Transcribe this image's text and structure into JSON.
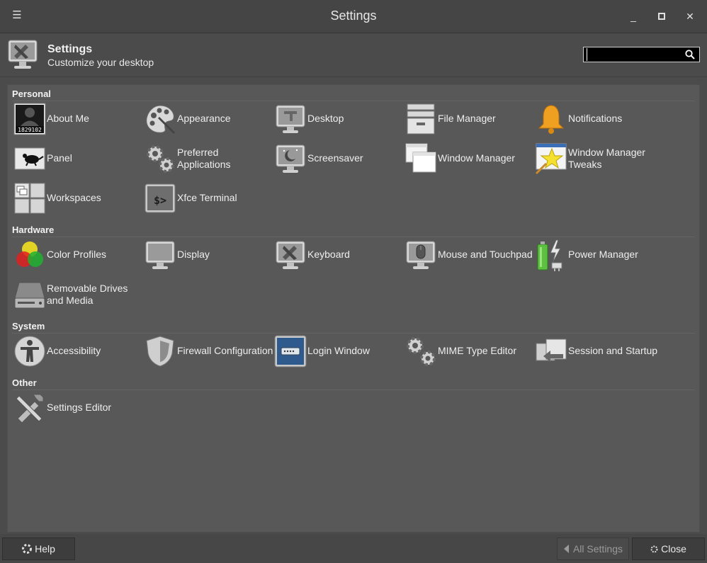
{
  "window": {
    "title": "Settings",
    "menu_icon": "hamburger-menu-icon",
    "minimize_glyph": "_",
    "maximize_glyph": "□",
    "close_glyph": "✕"
  },
  "header": {
    "title": "Settings",
    "subtitle": "Customize your desktop",
    "icon": "settings-tools-icon"
  },
  "search": {
    "value": "",
    "placeholder": "",
    "icon": "search-icon"
  },
  "sections": {
    "personal": {
      "title": "Personal",
      "items": [
        {
          "label": "About Me",
          "icon": "user-badge-icon",
          "badge": "1829102"
        },
        {
          "label": "Appearance",
          "icon": "palette-icon"
        },
        {
          "label": "Desktop",
          "icon": "desktop-monitor-icon"
        },
        {
          "label": "File Manager",
          "icon": "file-cabinet-icon"
        },
        {
          "label": "Notifications",
          "icon": "bell-icon"
        },
        {
          "label": "Panel",
          "icon": "panel-mouse-icon"
        },
        {
          "label": "Preferred\nApplications",
          "icon": "gears-icon"
        },
        {
          "label": "Screensaver",
          "icon": "screensaver-monitor-icon"
        },
        {
          "label": "Window Manager",
          "icon": "windows-icon"
        },
        {
          "label": "Window Manager\nTweaks",
          "icon": "star-window-icon"
        },
        {
          "label": "Workspaces",
          "icon": "workspaces-grid-icon"
        },
        {
          "label": "Xfce Terminal",
          "icon": "terminal-icon",
          "glyph": "$>"
        }
      ]
    },
    "hardware": {
      "title": "Hardware",
      "items": [
        {
          "label": "Color Profiles",
          "icon": "color-circles-icon"
        },
        {
          "label": "Display",
          "icon": "display-monitor-icon"
        },
        {
          "label": "Keyboard",
          "icon": "keyboard-tools-icon"
        },
        {
          "label": "Mouse and Touchpad",
          "icon": "mouse-monitor-icon"
        },
        {
          "label": "Power Manager",
          "icon": "battery-plug-icon"
        },
        {
          "label": "Removable Drives\nand Media",
          "icon": "drive-icon"
        }
      ]
    },
    "system": {
      "title": "System",
      "items": [
        {
          "label": "Accessibility",
          "icon": "accessibility-icon"
        },
        {
          "label": "Firewall Configuration",
          "icon": "shield-icon"
        },
        {
          "label": "Login Window",
          "icon": "login-window-icon"
        },
        {
          "label": "MIME Type Editor",
          "icon": "mime-gears-icon"
        },
        {
          "label": "Session and Startup",
          "icon": "session-arrow-icon"
        }
      ]
    },
    "other": {
      "title": "Other",
      "items": [
        {
          "label": "Settings Editor",
          "icon": "settings-editor-icon"
        }
      ]
    }
  },
  "footer": {
    "help_label": "Help",
    "help_icon": "lifebuoy-icon",
    "all_settings_label": "All Settings",
    "all_settings_icon": "chevron-left-icon",
    "close_label": "Close",
    "close_icon": "close-circle-icon"
  },
  "colors": {
    "window_bg": "#4b4b4b",
    "content_bg": "#585858",
    "titlebar_bg": "#454545",
    "text": "#eeeeee",
    "bell": "#f0a020",
    "battery": "#5cc040"
  }
}
